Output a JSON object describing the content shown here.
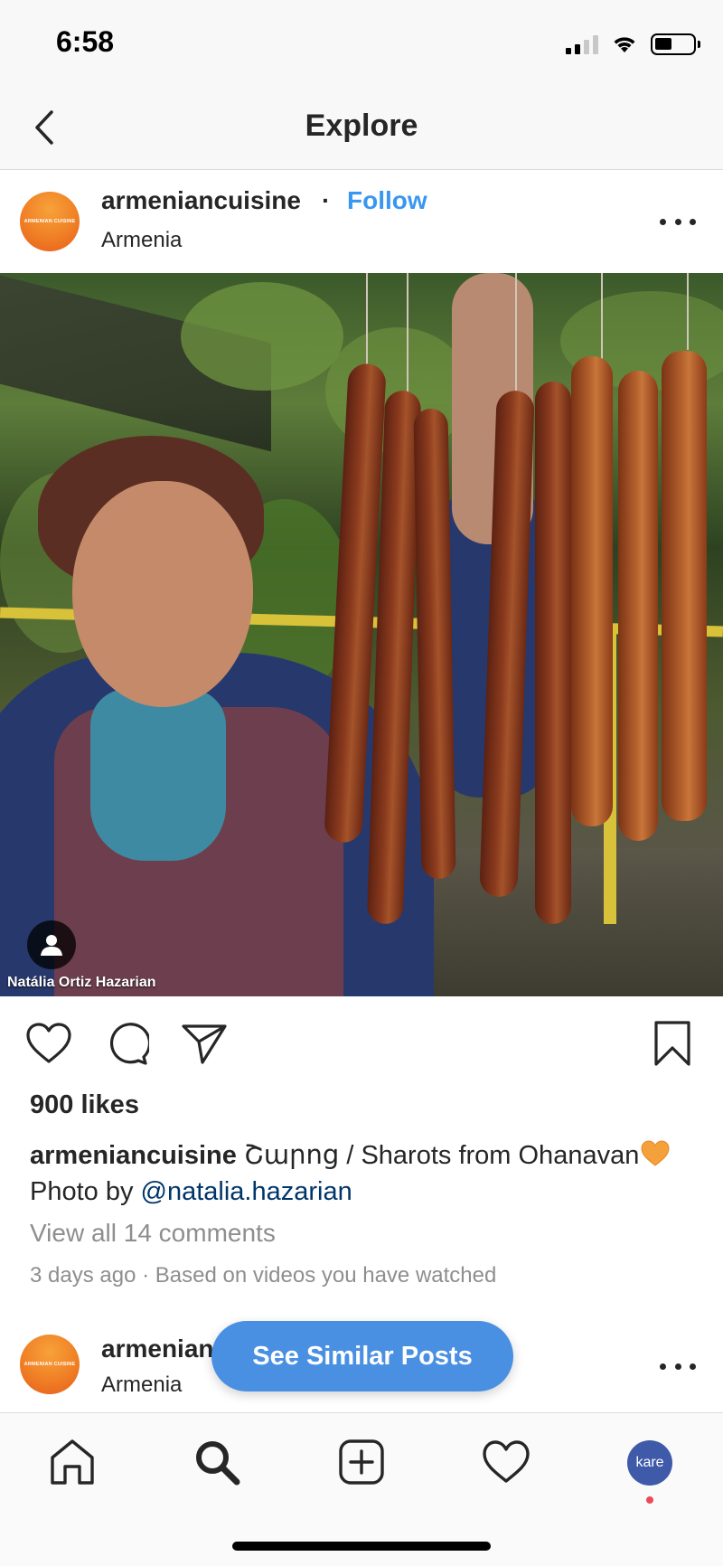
{
  "status_bar": {
    "time": "6:58",
    "battery_level": 0.45,
    "signal_bars_active": 2,
    "signal_bars_total": 4
  },
  "nav": {
    "back_icon": "chevron-left-icon",
    "title": "Explore"
  },
  "post": {
    "avatar_text": "ARMENIAN CUISINE",
    "username": "armeniancuisine",
    "separator": "·",
    "follow_label": "Follow",
    "location": "Armenia",
    "more_icon": "ellipsis-icon",
    "photo_credit": "Natália Ortiz Hazarian",
    "actions": {
      "like_icon": "heart-icon",
      "comment_icon": "comment-bubble-icon",
      "share_icon": "paper-plane-icon",
      "save_icon": "bookmark-icon"
    },
    "likes": "900 likes",
    "caption_user": "armeniancuisine",
    "caption_text": "Շարոց / Sharots from Ohanavan",
    "photo_by_prefix": "Photo by ",
    "photo_by_mention": "@natalia.hazarian",
    "view_comments": "View all 14 comments",
    "time_ago": "3 days ago",
    "meta_separator": " · ",
    "reason": "Based on videos you have watched"
  },
  "next_post": {
    "avatar_text": "ARMENIAN CUISINE",
    "username": "armenian",
    "location": "Armenia"
  },
  "similar_button": "See Similar Posts",
  "tab_bar": {
    "home_icon": "home-icon",
    "search_icon": "search-icon",
    "add_icon": "plus-square-icon",
    "activity_icon": "heart-icon",
    "profile_label": "kare"
  },
  "colors": {
    "link": "#3897f0",
    "mention": "#003569",
    "button": "#4a90e2",
    "notification": "#ed4956"
  }
}
